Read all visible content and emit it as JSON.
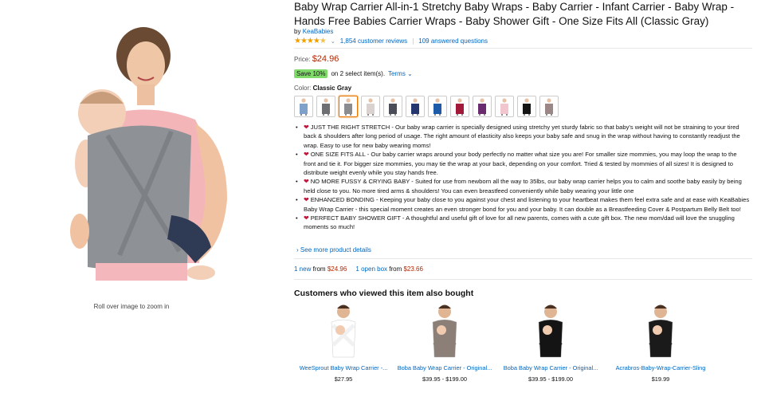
{
  "product": {
    "title": "Baby Wrap Carrier All-in-1 Stretchy Baby Wraps - Baby Carrier - Infant Carrier - Baby Wrap - Hands Free Babies Carrier Wraps - Baby Shower Gift - One Size Fits All (Classic Gray)",
    "brand_prefix": "by",
    "brand": "KeaBabies",
    "reviews": "1,854 customer reviews",
    "separator": "|",
    "answered": "109 answered questions",
    "price_label": "Price:",
    "price": "$24.96",
    "save_badge": "Save 10%",
    "save_text": "on 2 select item(s).",
    "terms": "Terms",
    "color_label": "Color:",
    "color_value": "Classic Gray",
    "zoom_hint": "Roll over image to zoom in"
  },
  "swatches": [
    {
      "color": "#7fa0c8",
      "selected": false
    },
    {
      "color": "#6d6f72",
      "selected": false
    },
    {
      "color": "#8a8c8f",
      "selected": true
    },
    {
      "color": "#d9d2cf",
      "selected": false
    },
    {
      "color": "#4a4c58",
      "selected": false
    },
    {
      "color": "#25356e",
      "selected": false
    },
    {
      "color": "#1d5aa8",
      "selected": false
    },
    {
      "color": "#a2193a",
      "selected": false
    },
    {
      "color": "#6a2c6e",
      "selected": false
    },
    {
      "color": "#f2c6cf",
      "selected": false
    },
    {
      "color": "#151515",
      "selected": false
    },
    {
      "color": "#9b8785",
      "selected": false
    }
  ],
  "bullets": [
    {
      "heading": "JUST THE RIGHT STRETCH -",
      "text": "Our baby wrap carrier is specially designed using stretchy yet sturdy fabric so that baby's weight will not be straining to your tired back & shoulders after long period of usage. The right amount of elasticity also keeps your baby safe and snug in the wrap without having to constantly readjust the wrap. Easy to use for new baby wearing moms!"
    },
    {
      "heading": "ONE SIZE FITS ALL -",
      "text": "Our baby carrier wraps around your body perfectly no matter what size you are! For smaller size mommies, you may loop the wrap to the front and tie it. For bigger size mommies, you may tie the wrap at your back, depending on your comfort. Tried & tested by mommies of all sizes! It is designed to distribute weight evenly while you stay hands free."
    },
    {
      "heading": "NO MORE FUSSY & CRYING BABY -",
      "text": "Suited for use from newborn all the way to 35lbs, our baby wrap carrier helps you to calm and soothe baby easily by being held close to you. No more tired arms & shoulders! You can even breastfeed conveniently while baby wearing your little one"
    },
    {
      "heading": "ENHANCED BONDING -",
      "text": "Keeping your baby close to you against your chest and listening to your heartbeat makes them feel extra safe and at ease with KeaBabies Baby Wrap Carrier - this special moment creates an even stronger bond for you and your baby. It can double as a Breastfeeding Cover & Postpartum Belly Belt too!"
    },
    {
      "heading": "PERFECT BABY SHOWER GIFT -",
      "text": "A thoughtful and useful gift of love for all new parents, comes with a cute gift box. The new mom/dad will love the snuggling moments so much!"
    }
  ],
  "see_more": "See more product details",
  "offers": {
    "new_count": "1 new",
    "new_from": "from",
    "new_price": "$24.96",
    "open_count": "1 open box",
    "open_from": "from",
    "open_price": "$23.66"
  },
  "also_bought": {
    "title": "Customers who viewed this item also bought",
    "items": [
      {
        "name": "WeeSprout Baby Wrap Carrier -...",
        "price": "$27.95",
        "wrap": "#efefef",
        "top": "#ffffff"
      },
      {
        "name": "Boba Baby Wrap Carrier - Original...",
        "price": "$39.95 - $199.00",
        "wrap": "#8b7f78",
        "top": "#8b7f78"
      },
      {
        "name": "Boba Baby Wrap Carrier - Original...",
        "price": "$39.95 - $199.00",
        "wrap": "#141414",
        "top": "#141414"
      },
      {
        "name": "Acrabros-Baby-Wrap-Carrier-Sling",
        "price": "$19.99",
        "wrap": "#1a1a1a",
        "top": "#1a1a1a"
      }
    ]
  }
}
